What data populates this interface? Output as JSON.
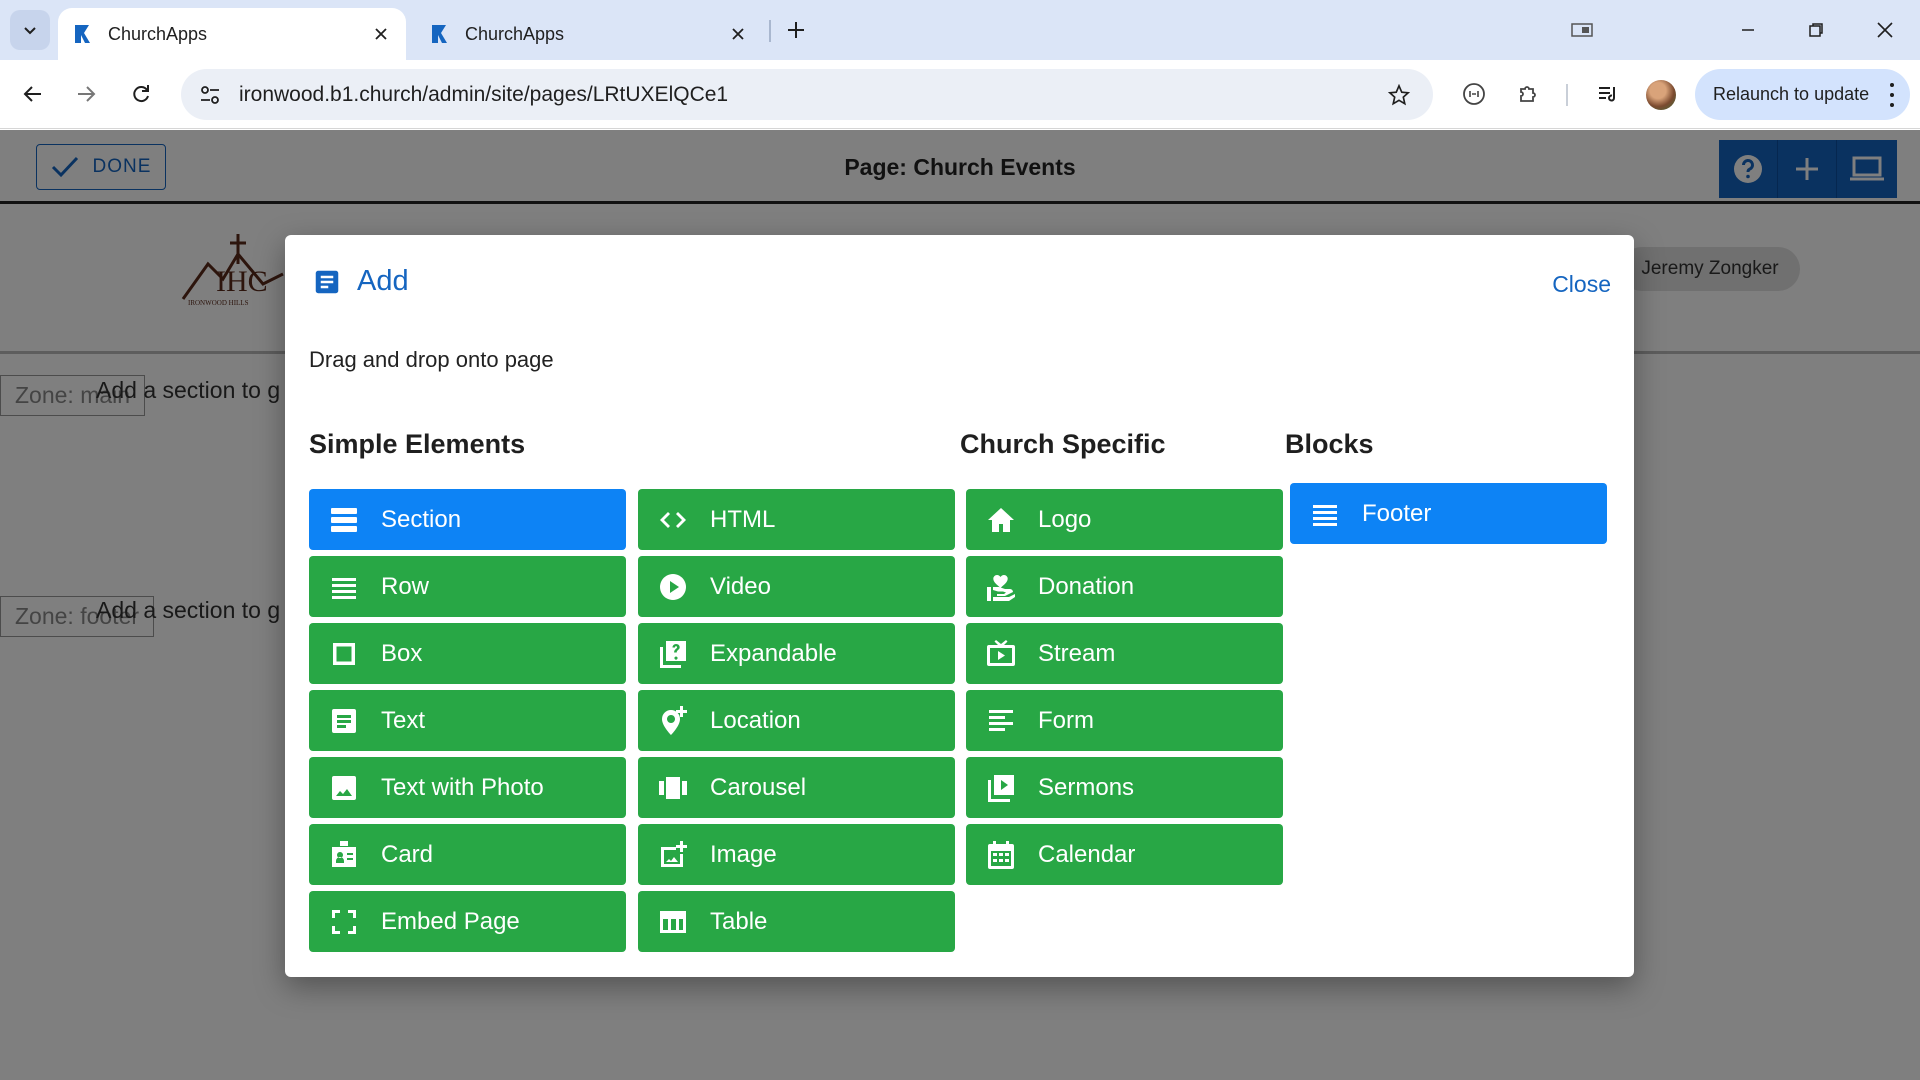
{
  "browser": {
    "tabs": [
      {
        "title": "ChurchApps",
        "active": true
      },
      {
        "title": "ChurchApps",
        "active": false
      }
    ],
    "url": "ironwood.b1.church/admin/site/pages/LRtUXElQCe1",
    "relaunch_label": "Relaunch to update"
  },
  "editor": {
    "done_label": "DONE",
    "page_title": "Page: Church Events",
    "user_name": "Jeremy Zongker",
    "zones": [
      {
        "label": "Zone: main",
        "hint": "Add a section to g"
      },
      {
        "label": "Zone: footer",
        "hint": "Add a section to g"
      }
    ]
  },
  "dialog": {
    "title": "Add",
    "close_label": "Close",
    "instructions": "Drag and drop onto page",
    "headings": {
      "simple": "Simple Elements",
      "church": "Church Specific",
      "blocks": "Blocks"
    },
    "simple_col1": [
      {
        "label": "Section",
        "icon": "section-icon",
        "color": "#0d83f5"
      },
      {
        "label": "Row",
        "icon": "row-icon",
        "color": "#28a745"
      },
      {
        "label": "Box",
        "icon": "box-icon",
        "color": "#28a745"
      },
      {
        "label": "Text",
        "icon": "text-icon",
        "color": "#28a745"
      },
      {
        "label": "Text with Photo",
        "icon": "photo-icon",
        "color": "#28a745"
      },
      {
        "label": "Card",
        "icon": "card-icon",
        "color": "#28a745"
      },
      {
        "label": "Embed Page",
        "icon": "embed-icon",
        "color": "#28a745"
      }
    ],
    "simple_col2": [
      {
        "label": "HTML",
        "icon": "code-icon",
        "color": "#28a745"
      },
      {
        "label": "Video",
        "icon": "play-icon",
        "color": "#28a745"
      },
      {
        "label": "Expandable",
        "icon": "help-box-icon",
        "color": "#28a745"
      },
      {
        "label": "Location",
        "icon": "add-location-icon",
        "color": "#28a745"
      },
      {
        "label": "Carousel",
        "icon": "carousel-icon",
        "color": "#28a745"
      },
      {
        "label": "Image",
        "icon": "add-image-icon",
        "color": "#28a745"
      },
      {
        "label": "Table",
        "icon": "table-icon",
        "color": "#28a745"
      }
    ],
    "church": [
      {
        "label": "Logo",
        "icon": "home-icon",
        "color": "#28a745"
      },
      {
        "label": "Donation",
        "icon": "donation-icon",
        "color": "#28a745"
      },
      {
        "label": "Stream",
        "icon": "live-tv-icon",
        "color": "#28a745"
      },
      {
        "label": "Form",
        "icon": "form-icon",
        "color": "#28a745"
      },
      {
        "label": "Sermons",
        "icon": "video-library-icon",
        "color": "#28a745"
      },
      {
        "label": "Calendar",
        "icon": "calendar-icon",
        "color": "#28a745"
      }
    ],
    "blocks": [
      {
        "label": "Footer",
        "icon": "footer-icon",
        "color": "#0d83f5"
      }
    ]
  }
}
